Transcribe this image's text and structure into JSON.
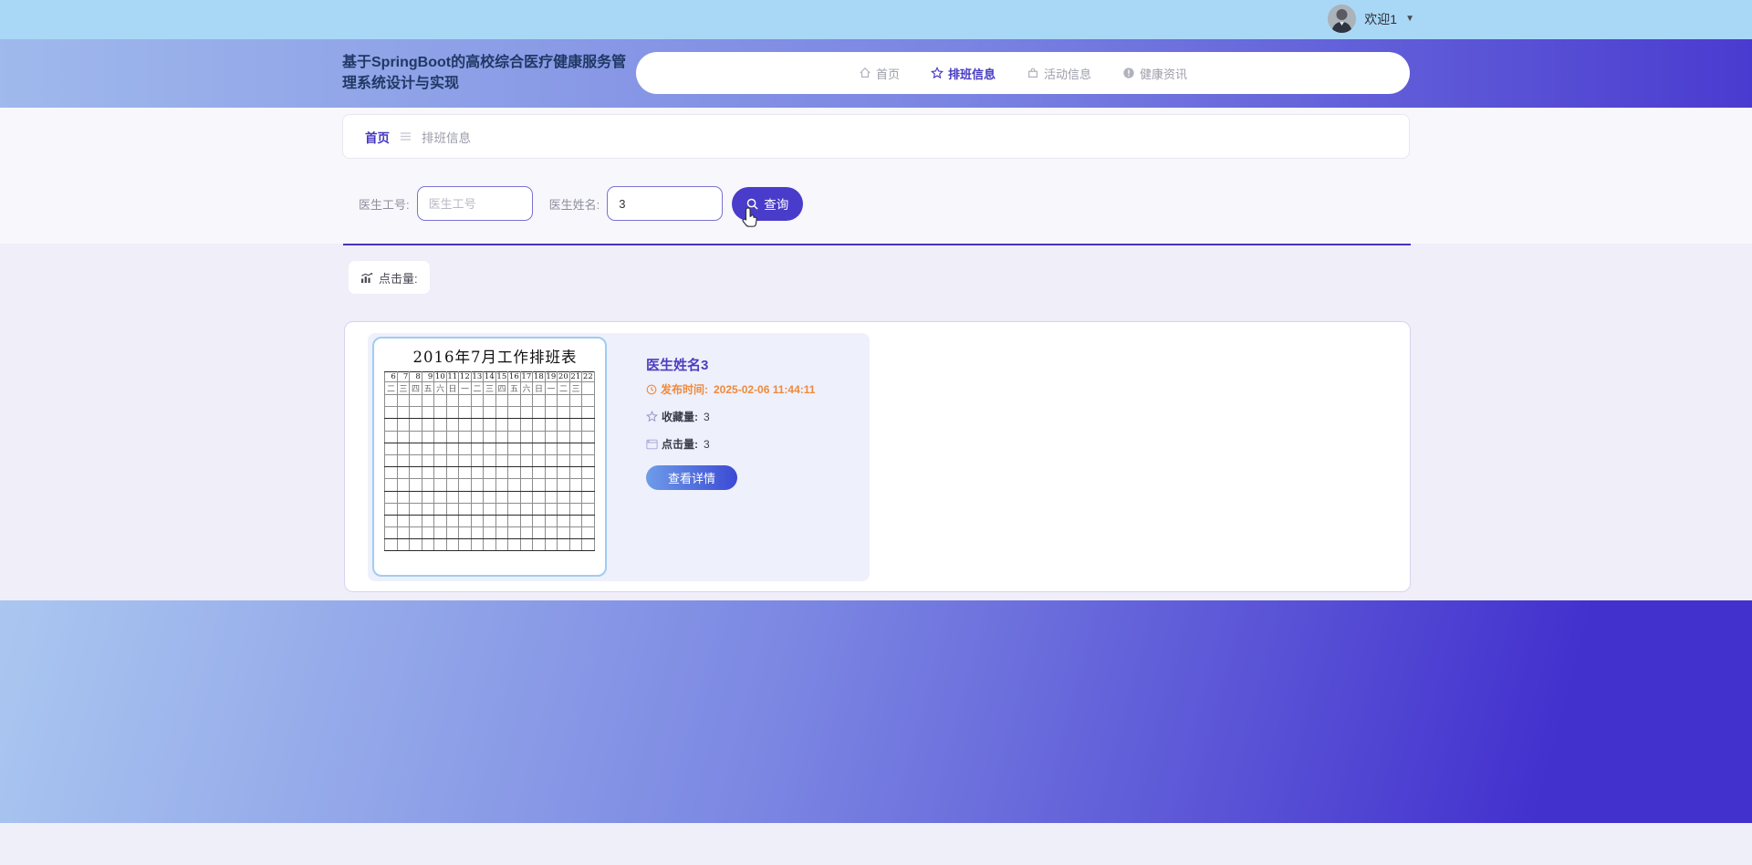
{
  "topbar": {
    "welcome_text": "欢迎1"
  },
  "header": {
    "title": "基于SpringBoot的高校综合医疗健康服务管理系统设计与实现",
    "nav": [
      {
        "label": "首页",
        "icon": "home-icon",
        "active": false
      },
      {
        "label": "排班信息",
        "icon": "star-icon",
        "active": true
      },
      {
        "label": "活动信息",
        "icon": "bag-icon",
        "active": false
      },
      {
        "label": "健康资讯",
        "icon": "info-icon",
        "active": false
      }
    ]
  },
  "breadcrumb": {
    "home": "首页",
    "current": "排班信息"
  },
  "search": {
    "id_label": "医生工号:",
    "id_placeholder": "医生工号",
    "id_value": "",
    "name_label": "医生姓名:",
    "name_value": "3",
    "button_label": "查询"
  },
  "stats_bar": {
    "clicks_label": "点击量:"
  },
  "result_card": {
    "schedule_image": {
      "title": "2016年7月工作排班表",
      "day_numbers": [
        "6",
        "7",
        "8",
        "9",
        "10",
        "11",
        "12",
        "13",
        "14",
        "15",
        "16",
        "17",
        "18",
        "19",
        "20",
        "21",
        "22"
      ],
      "weekdays": [
        "二",
        "三",
        "四",
        "五",
        "六",
        "日",
        "一",
        "二",
        "三",
        "四",
        "五",
        "六",
        "日",
        "一",
        "二",
        "三",
        ""
      ],
      "empty_rows": 13
    },
    "doctor": {
      "name": "医生姓名3",
      "publish_label": "发布时间:",
      "publish_time": "2025-02-06 11:44:11",
      "favorites_label": "收藏量:",
      "favorites_value": "3",
      "clicks_label": "点击量:",
      "clicks_value": "3",
      "detail_button": "查看详情"
    }
  },
  "colors": {
    "accent": "#4a3ccb",
    "nav_active": "#4539c2",
    "publish_time": "#ef8a3e",
    "topbar_bg": "#a9d8f6",
    "header_gradient_start": "#9fb9ec",
    "header_gradient_end": "#4a3bd0",
    "footer_gradient_start": "#aac7f0",
    "footer_gradient_end": "#4331ce"
  }
}
